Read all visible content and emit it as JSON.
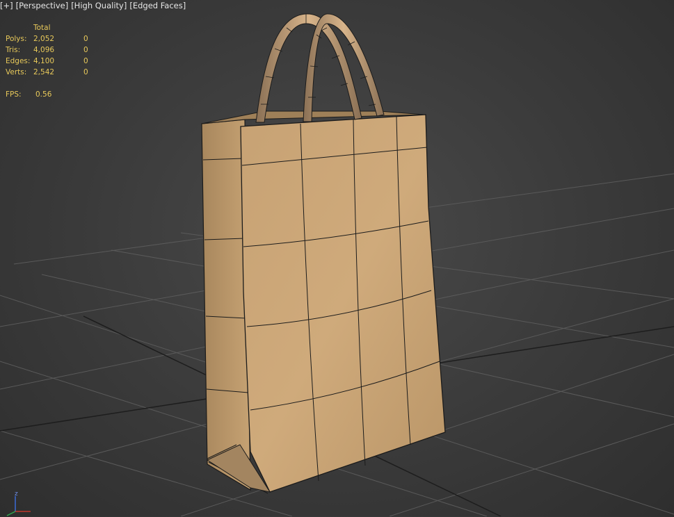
{
  "viewport": {
    "labels": [
      "[+]",
      "[Perspective]",
      "[High Quality]",
      "[Edged Faces]"
    ]
  },
  "stats": {
    "header": "Total",
    "rows": [
      {
        "label": "Polys:",
        "total": "2,052",
        "selected": "0"
      },
      {
        "label": "Tris:",
        "total": "4,096",
        "selected": "0"
      },
      {
        "label": "Edges:",
        "total": "4,100",
        "selected": "0"
      },
      {
        "label": "Verts:",
        "total": "2,542",
        "selected": "0"
      }
    ],
    "fps_label": "FPS:",
    "fps_value": "0.56"
  },
  "gizmo": {
    "axis_z": "z"
  },
  "colors": {
    "background": "#3a3a3a",
    "grid": "#565656",
    "grid_dark": "#1e1e1e",
    "stats_text": "#e8c95a",
    "bag_paper": "#c9a57a",
    "wire": "#1b1b1b"
  }
}
